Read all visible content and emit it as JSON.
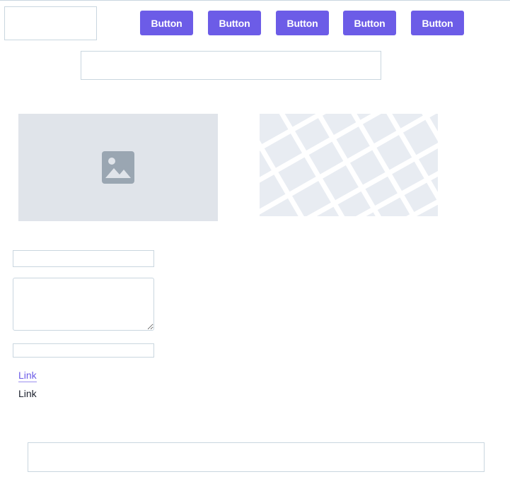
{
  "header": {
    "buttons": [
      {
        "label": "Button"
      },
      {
        "label": "Button"
      },
      {
        "label": "Button"
      },
      {
        "label": "Button"
      },
      {
        "label": "Button"
      }
    ]
  },
  "media": {
    "image_icon": "image-placeholder-icon",
    "map_icon": "map-placeholder"
  },
  "form": {
    "text_input_value": "",
    "textarea_value": "",
    "select_value": ""
  },
  "links": {
    "primary_label": "Link",
    "secondary_label": "Link"
  },
  "footer": {
    "input_value": ""
  },
  "colors": {
    "accent": "#6c5ce7",
    "border": "#c9d6df",
    "image_bg": "#e0e4ea",
    "image_icon": "#9aa6b2",
    "map_bg": "#e8ecf2",
    "map_road": "#ffffff"
  }
}
